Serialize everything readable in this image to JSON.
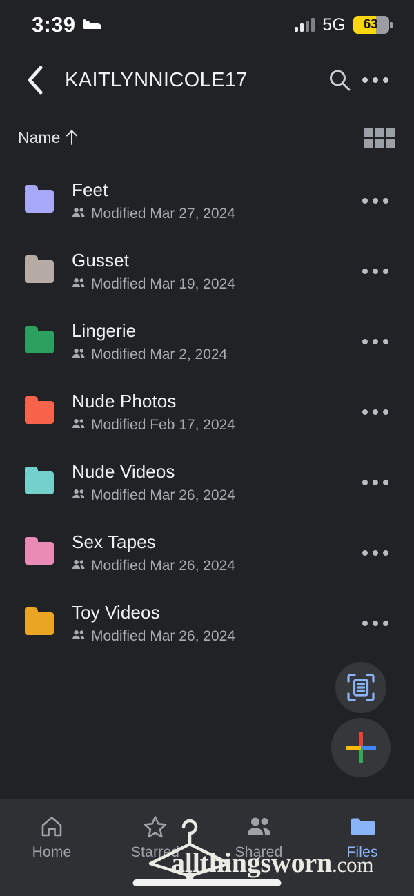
{
  "status_bar": {
    "time": "3:39",
    "sleep_icon": "bed-icon",
    "network": "5G",
    "signal_icon": "cellular-signal-icon",
    "battery_percent": "63",
    "battery_level": 63,
    "battery_low_power_color": "#ffd60a"
  },
  "header": {
    "back_icon": "chevron-left-icon",
    "title": "KAITLYNNICOLE17",
    "search_icon": "search-icon",
    "overflow_icon": "more-horizontal-icon"
  },
  "sort_bar": {
    "sort_label": "Name",
    "sort_direction_icon": "arrow-up-icon",
    "view_toggle_icon": "grid-view-icon"
  },
  "files": [
    {
      "name": "Feet",
      "modified": "Modified Mar 27, 2024",
      "color": "#a7a8f7",
      "shared": true
    },
    {
      "name": "Gusset",
      "modified": "Modified Mar 19, 2024",
      "color": "#b6aba5",
      "shared": true
    },
    {
      "name": "Lingerie",
      "modified": "Modified Mar 2, 2024",
      "color": "#2ba05f",
      "shared": true
    },
    {
      "name": "Nude Photos",
      "modified": "Modified Feb 17, 2024",
      "color": "#f8634c",
      "shared": true
    },
    {
      "name": "Nude Videos",
      "modified": "Modified Mar 26, 2024",
      "color": "#73d0cd",
      "shared": true
    },
    {
      "name": "Sex Tapes",
      "modified": "Modified Mar 26, 2024",
      "color": "#e98bb4",
      "shared": true
    },
    {
      "name": "Toy Videos",
      "modified": "Modified Mar 26, 2024",
      "color": "#eaa523",
      "shared": true
    }
  ],
  "fabs": {
    "scan_icon": "document-scan-icon",
    "create_icon": "plus-icon"
  },
  "bottom_nav": {
    "active": "Files",
    "items": [
      {
        "label": "Home",
        "icon": "home-icon",
        "active": false
      },
      {
        "label": "Starred",
        "icon": "star-icon",
        "active": false
      },
      {
        "label": "Shared",
        "icon": "people-icon",
        "active": false
      },
      {
        "label": "Files",
        "icon": "folder-icon",
        "active": true
      }
    ],
    "active_color": "#8ab4f8"
  },
  "watermark": {
    "brand": "allthingsworn",
    "tld": ".com",
    "logo_icon": "clothes-hanger-icon"
  }
}
